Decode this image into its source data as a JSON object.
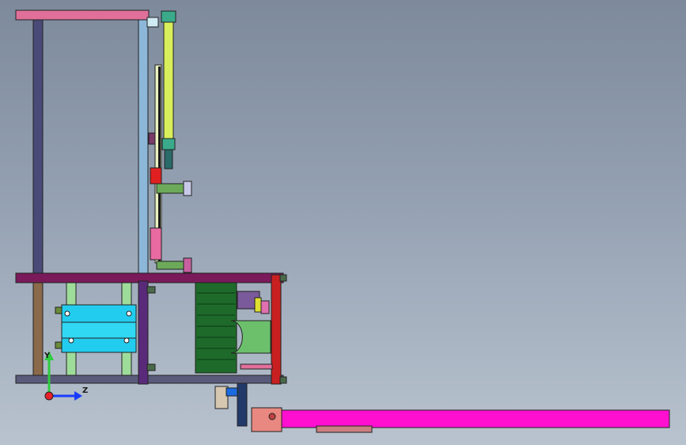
{
  "view": {
    "background_top": "#7d8a9c",
    "background_bottom": "#b9c3cf"
  },
  "triad": {
    "y_label": "Y",
    "z_label": "Z",
    "y_color": "#2ecc40",
    "z_color": "#1a3cff",
    "origin_color": "#e8202a"
  },
  "colors": {
    "frame_top_rail": "#e0709a",
    "frame_left_post": "#4a4a78",
    "frame_light_post": "#8cb7d8",
    "frame_mid_beam": "#7a1a5a",
    "frame_base_rail": "#5a5a7a",
    "cylinder_yellow": "#d8ee5a",
    "block_cyan": "#22ccee",
    "post_green": "#9edc9a",
    "motor_dark_green": "#1e6a2a",
    "mount_light_green": "#6cc06c",
    "bracket_red": "#c82020",
    "conveyor_magenta": "#ff10d0",
    "end_bracket_salmon": "#e88880"
  }
}
